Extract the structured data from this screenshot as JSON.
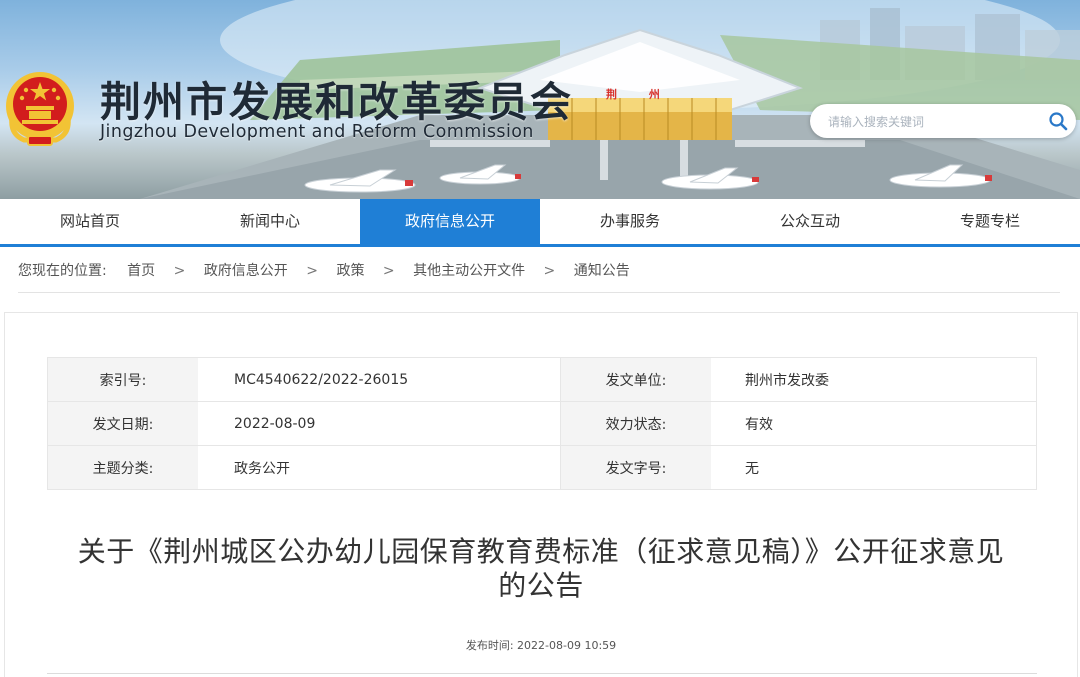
{
  "header": {
    "title": "荆州市发展和改革委员会",
    "subtitle": "Jingzhou Development and Reform Commission",
    "search_placeholder": "请输入搜索关键词",
    "airport_sign": "荆 州"
  },
  "nav": {
    "items": [
      "网站首页",
      "新闻中心",
      "政府信息公开",
      "办事服务",
      "公众互动",
      "专题专栏"
    ],
    "active": "政府信息公开"
  },
  "breadcrumb": {
    "lead": "您现在的位置:",
    "items": [
      "首页",
      "政府信息公开",
      "政策",
      "其他主动公开文件",
      "通知公告"
    ],
    "separator": ">"
  },
  "meta": {
    "index_label": "索引号:",
    "index_value": "MC4540622/2022-26015",
    "issuer_label": "发文单位:",
    "issuer_value": "荆州市发改委",
    "date_label": "发文日期:",
    "date_value": "2022-08-09",
    "status_label": "效力状态:",
    "status_value": "有效",
    "topic_label": "主题分类:",
    "topic_value": "政务公开",
    "docno_label": "发文字号:",
    "docno_value": "无"
  },
  "article": {
    "title_line1": "关于《荆州城区公办幼儿园保育教育费标准（征求意见稿）》公开征求意见",
    "title_line2": "的公告",
    "published_label": "发布时间:",
    "published_value": "2022-08-09 10:59"
  },
  "colors": {
    "accent": "#1f7fd6",
    "table_key_bg": "#f4f4f4",
    "emblem_red": "#d21d1d",
    "emblem_gold": "#f2c335"
  },
  "icons": [
    "national-emblem-icon",
    "search-icon"
  ]
}
